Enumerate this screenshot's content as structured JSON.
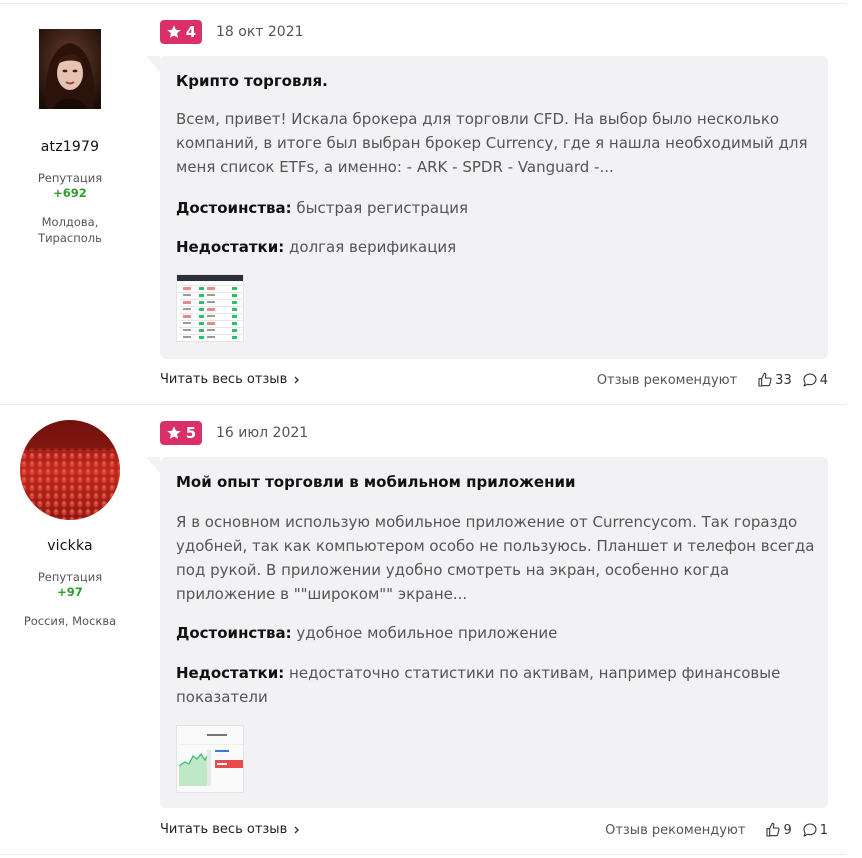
{
  "reviews": [
    {
      "user": {
        "name": "atz1979",
        "reputation_label": "Репутация",
        "reputation_value": "+692",
        "location_line1": "Молдова,",
        "location_line2": "Тирасполь"
      },
      "rating": "4",
      "date": "18 окт 2021",
      "title": "Крипто торговля.",
      "text": "Всем, привет! Искала брокера для торговли CFD. На выбор было несколько компаний, в итоге был выбран брокер Currency, где я нашла необходимый для меня список ETFs, а именно: - ARK - SPDR - Vanguard -...",
      "pros_label": "Достоинства:",
      "pros": "быстрая регистрация",
      "cons_label": "Недостатки:",
      "cons": "долгая верификация",
      "read_more": "Читать весь отзыв",
      "recommend_label": "Отзыв рекомендуют",
      "likes": "33",
      "comments": "4"
    },
    {
      "user": {
        "name": "vickka",
        "reputation_label": "Репутация",
        "reputation_value": "+97",
        "location_line1": "Россия, Москва",
        "location_line2": ""
      },
      "rating": "5",
      "date": "16 июл 2021",
      "title": "Мой опыт торговли в мобильном приложении",
      "text": "Я в основном использую мобильное приложение от Currencycom. Так гораздо удобней, так как компьютером особо не пользуюсь. Планшет и телефон всегда под рукой. В приложении удобно смотреть на экран, особенно когда приложение в \"\"широком\"\" экране...",
      "pros_label": "Достоинства:",
      "pros": "удобное мобильное приложение",
      "cons_label": "Недостатки:",
      "cons": "недостаточно статистики по активам, например финансовые показатели",
      "read_more": "Читать весь отзыв",
      "recommend_label": "Отзыв рекомендуют",
      "likes": "9",
      "comments": "1"
    }
  ],
  "colors": {
    "badge": "#d9306a",
    "reputation": "#2e9c2e",
    "bubble": "#f2f2f4"
  },
  "icons": {
    "star": "star-icon",
    "like": "thumbs-up-icon",
    "comment": "comment-icon",
    "chevron": "chevron-right-icon"
  }
}
